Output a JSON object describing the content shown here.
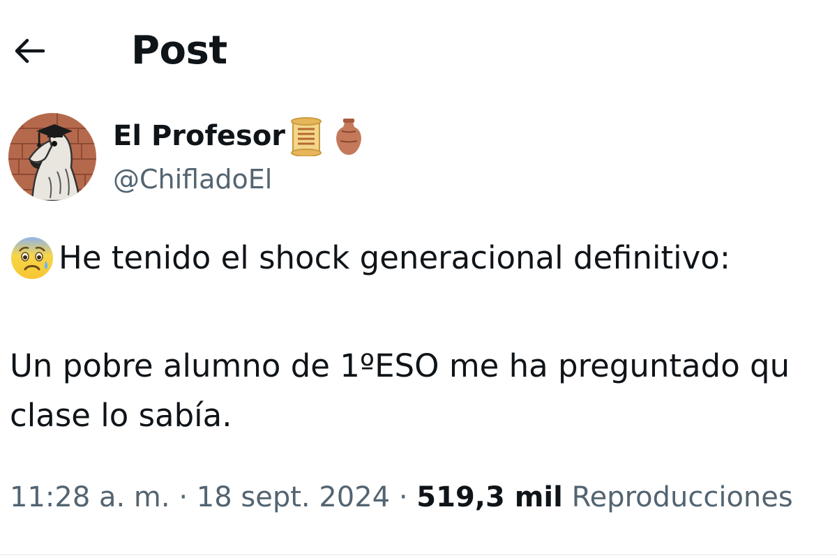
{
  "header": {
    "back_icon": "arrow-left-icon",
    "title": "Post"
  },
  "author": {
    "display_name": "El Profesor",
    "handle": "@ChifladoEl",
    "avatar_icon": "llama-graduation-cap-avatar",
    "badges": [
      "scroll-emoji",
      "amphora-emoji"
    ]
  },
  "post": {
    "emoji_icon": "anxious-face-emoji",
    "line1": "He tenido el shock generacional definitivo:",
    "line2": "Un pobre alumno de 1ºESO me ha preguntado qu",
    "line3": "clase lo sabía."
  },
  "meta": {
    "time": "11:28 a. m.",
    "sep1": " · ",
    "date": "18 sept. 2024",
    "sep2": " · ",
    "views_count": "519,3 mil",
    "views_label": " Reproducciones"
  },
  "colors": {
    "text_primary": "#0f1419",
    "text_secondary": "#536471",
    "divider": "#e7e7e7"
  }
}
